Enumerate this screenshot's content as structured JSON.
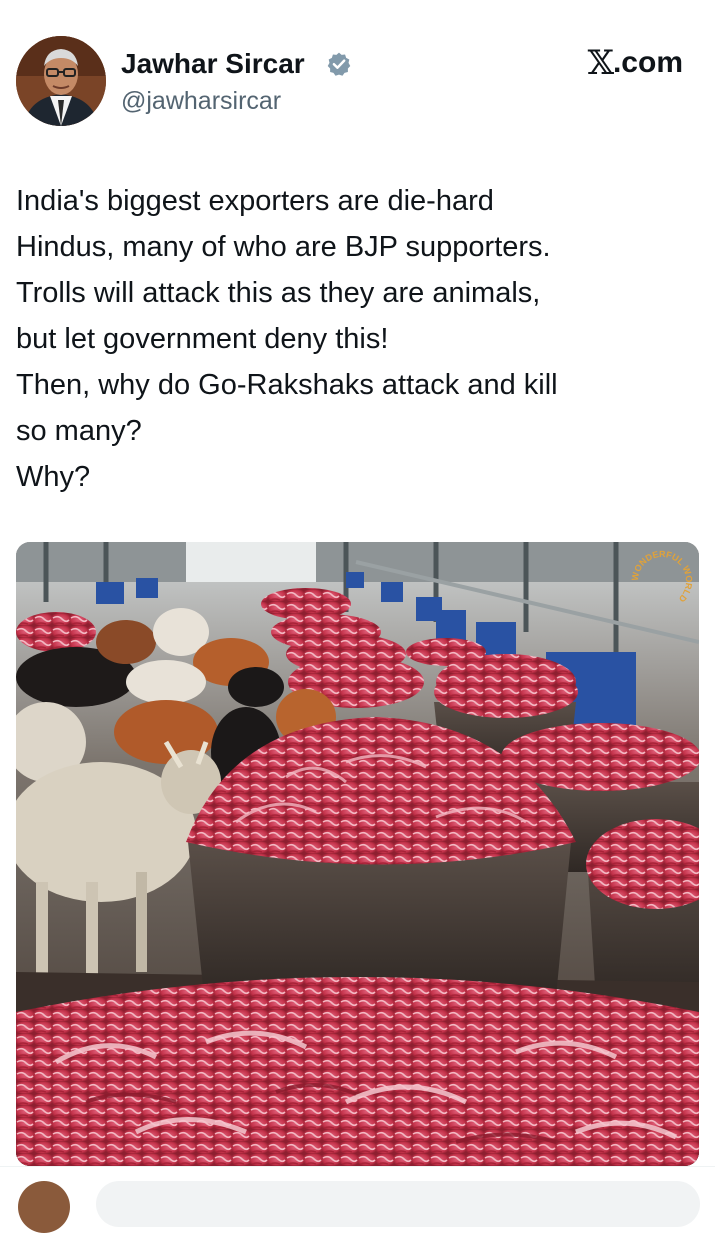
{
  "author": {
    "name": "Jawhar Sircar",
    "handle": "@jawharsircar",
    "verified": true,
    "avatar_icon": "profile-photo"
  },
  "brand": {
    "logo": "𝕏",
    "suffix": ".com"
  },
  "tweet": {
    "lines": [
      "India's biggest exporters are die-hard",
      "Hindus, many of who are BJP supporters.",
      "Trolls will attack this as they are animals,",
      "but let government deny this!",
      "Then, why do Go-Rakshaks attack and kill",
      "so many?",
      "Why?"
    ]
  },
  "media": {
    "watermark_text": "WONDERFUL WORLD"
  },
  "colors": {
    "text": "#0f1419",
    "secondary": "#536471",
    "verified": "#829aab",
    "meat": "#c4324a"
  }
}
